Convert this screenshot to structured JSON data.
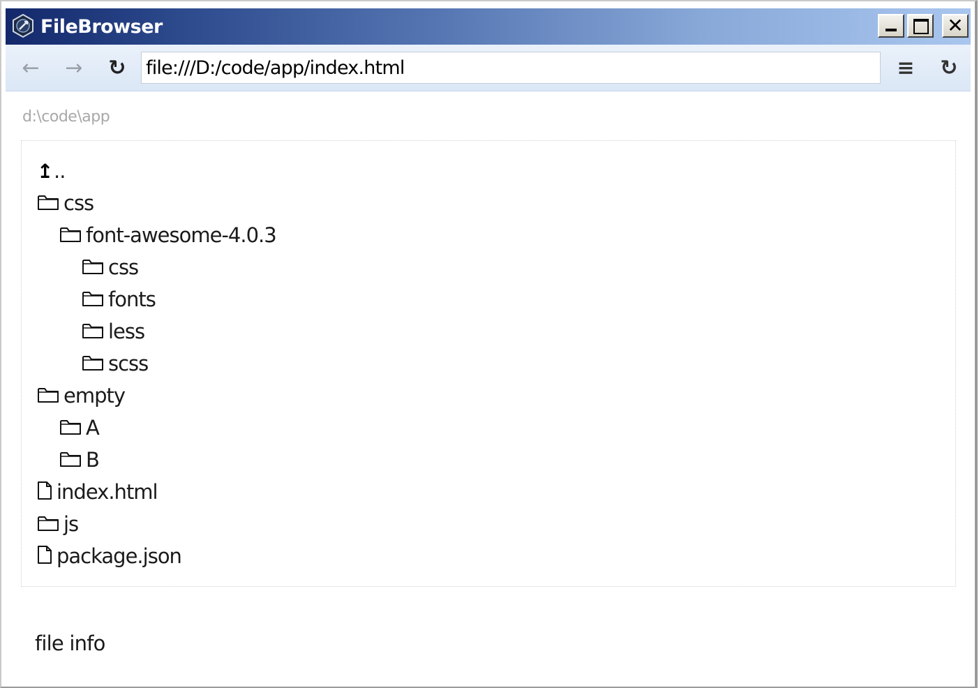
{
  "window": {
    "title": "FileBrowser",
    "app_icon": "filebrowser-logo-icon",
    "controls": {
      "minimize_icon": "minimize-icon",
      "maximize_icon": "maximize-icon",
      "close_glyph": "✕"
    }
  },
  "toolbar": {
    "back_glyph": "←",
    "forward_glyph": "→",
    "reload_glyph": "↻",
    "address_value": "file:///D:/code/app/index.html",
    "menu_glyph": "≡",
    "reload2_glyph": "↻"
  },
  "path": "d:\\code\\app",
  "tree": {
    "up": {
      "arrow": "↥",
      "label": ".."
    },
    "items": [
      {
        "type": "folder",
        "label": "css",
        "depth": 0
      },
      {
        "type": "folder",
        "label": "font-awesome-4.0.3",
        "depth": 1
      },
      {
        "type": "folder",
        "label": "css",
        "depth": 2
      },
      {
        "type": "folder",
        "label": "fonts",
        "depth": 2
      },
      {
        "type": "folder",
        "label": "less",
        "depth": 2
      },
      {
        "type": "folder",
        "label": "scss",
        "depth": 2
      },
      {
        "type": "folder",
        "label": "empty",
        "depth": 0
      },
      {
        "type": "folder",
        "label": "A",
        "depth": 1
      },
      {
        "type": "folder",
        "label": "B",
        "depth": 1
      },
      {
        "type": "file",
        "label": "index.html",
        "depth": 0
      },
      {
        "type": "folder",
        "label": "js",
        "depth": 0
      },
      {
        "type": "file",
        "label": "package.json",
        "depth": 0
      }
    ]
  },
  "file_info": "file info"
}
